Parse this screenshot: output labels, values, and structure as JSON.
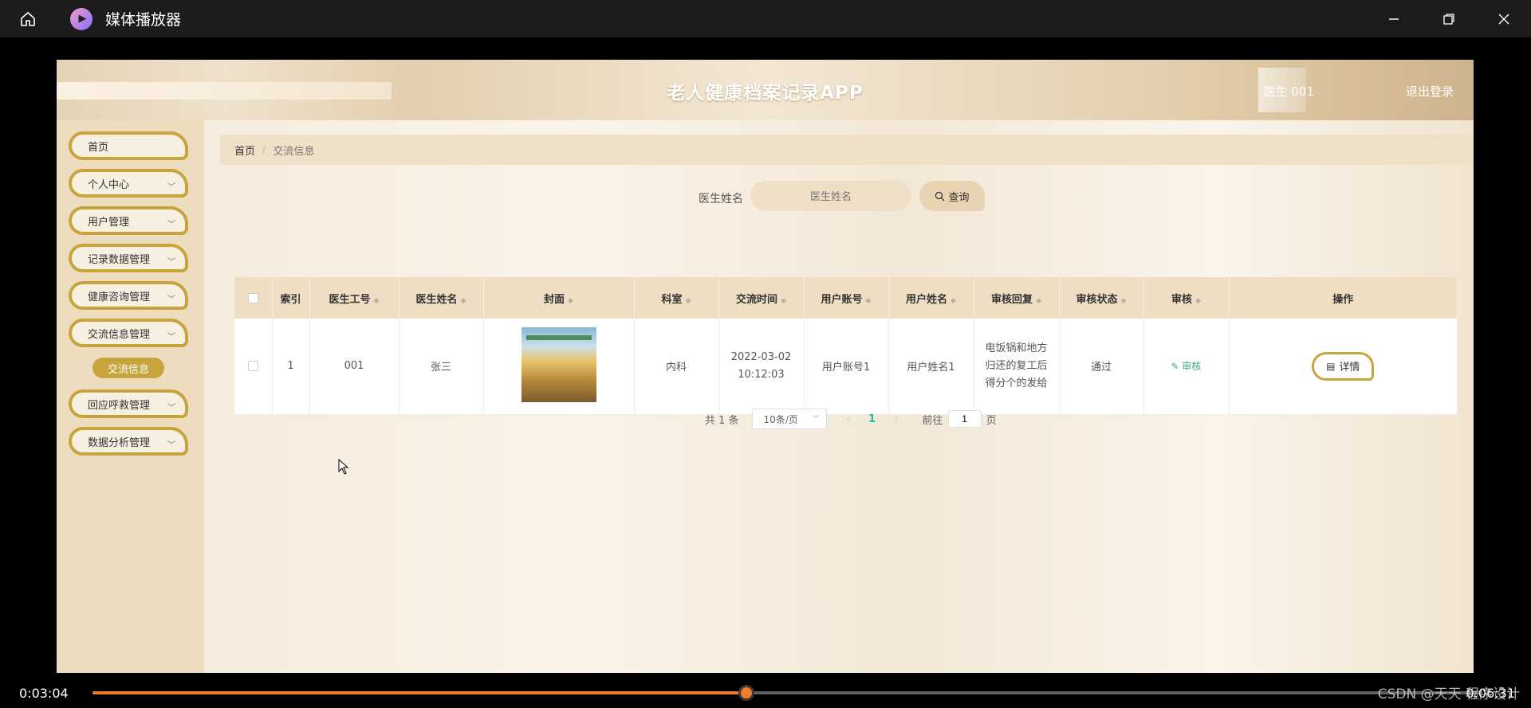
{
  "player": {
    "title": "媒体播放器",
    "current_time": "0:03:04",
    "total_time": "0:06:31",
    "progress": 0.471,
    "watermark": "CSDN @天天 程序设计",
    "accent": "#f07d2b"
  },
  "app": {
    "title": "老人健康档案记录APP",
    "user": "医生 001",
    "logout": "退出登录"
  },
  "sidebar": {
    "items": [
      {
        "label": "首页"
      },
      {
        "label": "个人中心"
      },
      {
        "label": "用户管理"
      },
      {
        "label": "记录数据管理"
      },
      {
        "label": "健康咨询管理"
      },
      {
        "label": "交流信息管理"
      },
      {
        "label": "回应呼救管理"
      },
      {
        "label": "数据分析管理"
      }
    ],
    "sub_active": "交流信息"
  },
  "breadcrumb": {
    "home": "首页",
    "current": "交流信息"
  },
  "search": {
    "label": "医生姓名",
    "placeholder": "医生姓名",
    "button": "查询"
  },
  "table": {
    "columns": [
      "索引",
      "医生工号",
      "医生姓名",
      "封面",
      "科室",
      "交流时间",
      "用户账号",
      "用户姓名",
      "审核回复",
      "审核状态",
      "审核",
      "操作"
    ],
    "rows": [
      {
        "index": "1",
        "doctor_id": "001",
        "doctor_name": "张三",
        "department": "内科",
        "time": "2022-03-02 10:12:03",
        "user_account": "用户账号1",
        "user_name": "用户姓名1",
        "reply": "电饭锅和地方归还的复工后得分个的发给",
        "status": "通过",
        "audit": "审核",
        "detail": "详情"
      }
    ]
  },
  "pagination": {
    "total": "共 1 条",
    "page_size": "10条/页",
    "current": "1",
    "goto_prefix": "前往",
    "goto_value": "1",
    "goto_suffix": "页"
  }
}
